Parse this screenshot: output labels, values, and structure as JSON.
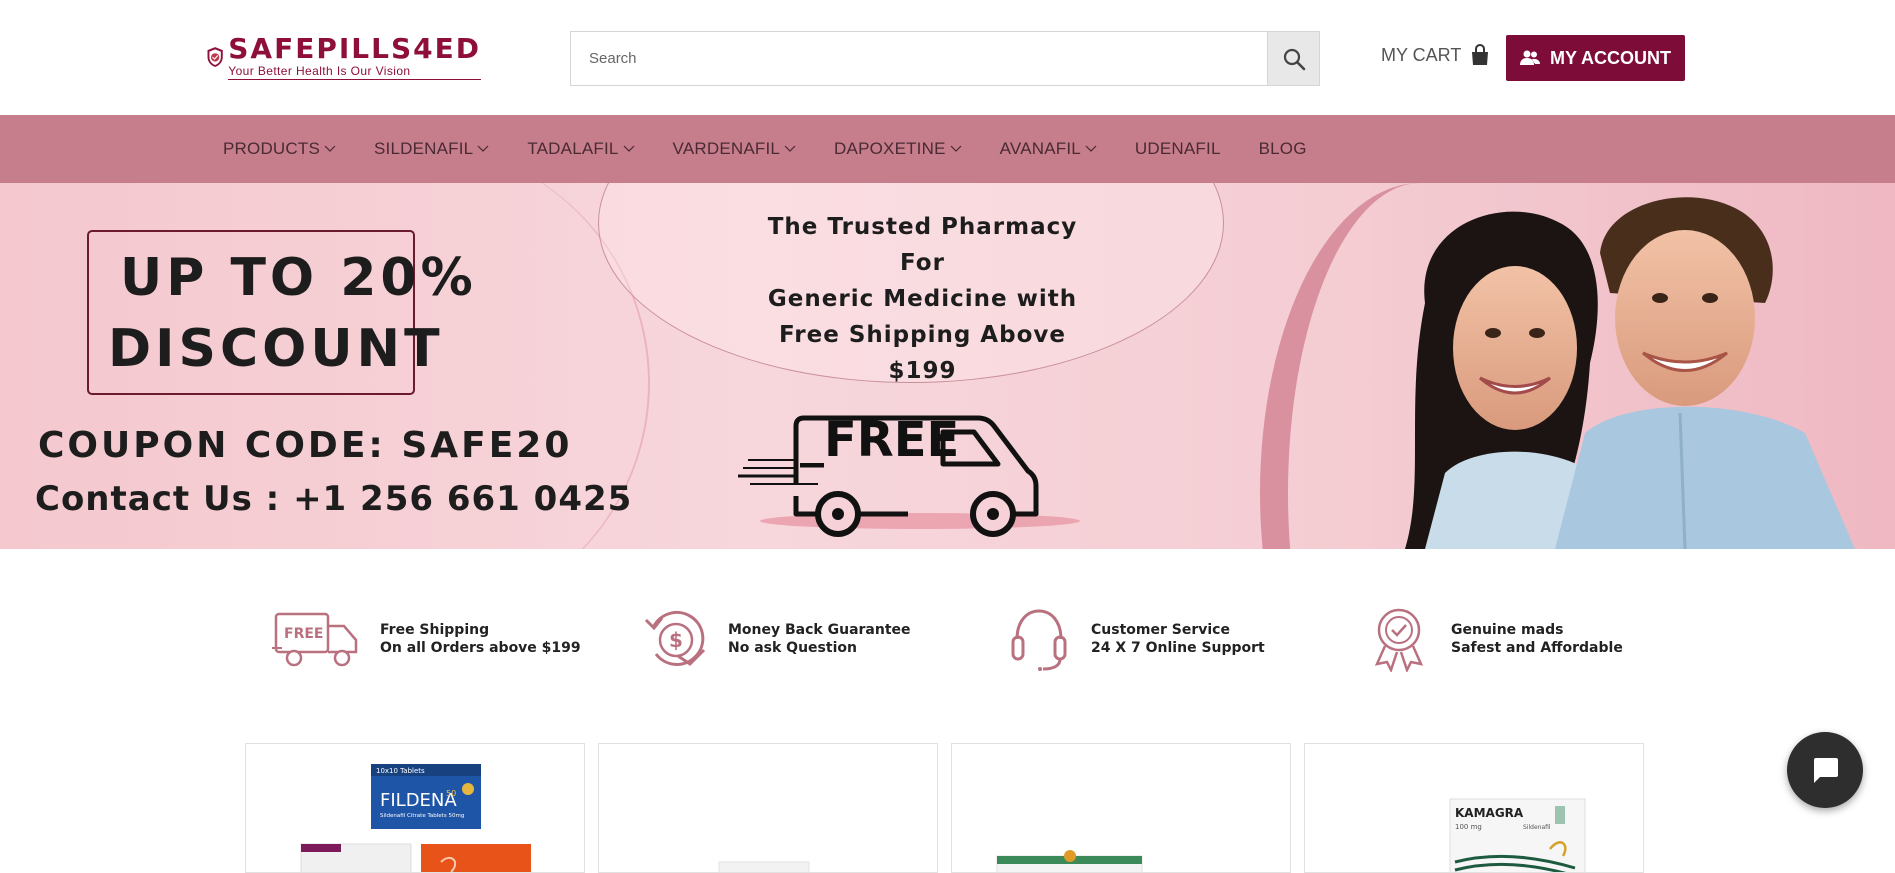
{
  "header": {
    "logo_name": "SAFEPILLS4ED",
    "logo_tagline": "Your Better Health Is Our Vision",
    "search_placeholder": "Search",
    "cart_label": "MY CART",
    "account_label": "MY ACCOUNT"
  },
  "nav": {
    "items": [
      {
        "label": "PRODUCTS",
        "has_dropdown": true
      },
      {
        "label": "SILDENAFIL",
        "has_dropdown": true
      },
      {
        "label": "TADALAFIL",
        "has_dropdown": true
      },
      {
        "label": "VARDENAFIL",
        "has_dropdown": true
      },
      {
        "label": "DAPOXETINE",
        "has_dropdown": true
      },
      {
        "label": "AVANAFIL",
        "has_dropdown": true
      },
      {
        "label": "UDENAFIL",
        "has_dropdown": false
      },
      {
        "label": "BLOG",
        "has_dropdown": false
      }
    ]
  },
  "banner": {
    "discount_line1": "UP TO 20%",
    "discount_line2": "DISCOUNT",
    "coupon": "COUPON CODE: SAFE20",
    "contact": "Contact Us : +1 256 661 0425",
    "trusted_line1": "The Trusted Pharmacy For",
    "trusted_line2": "Generic Medicine with",
    "trusted_line3": "Free Shipping Above $199",
    "truck_label": "_FREE"
  },
  "features": [
    {
      "icon": "free-shipping-truck-icon",
      "line1": "Free Shipping",
      "line2": "On all  Orders above $199"
    },
    {
      "icon": "money-back-icon",
      "line1": "Money Back Guarantee",
      "line2": "No ask Question"
    },
    {
      "icon": "headset-icon",
      "line1": "Customer Service",
      "line2": "24 X 7 Online Support"
    },
    {
      "icon": "award-badge-icon",
      "line1": "Genuine mads",
      "line2": "Safest and Affordable"
    }
  ],
  "products": [
    {
      "box_brand": "FILDENA",
      "box_strength": "50",
      "box_top": "10x10 Tablets",
      "box_sub": "Sildenafil Citrate Tablets 50mg"
    },
    {
      "box_brand": "",
      "box_strength": "",
      "box_top": "",
      "box_sub": ""
    },
    {
      "box_brand": "",
      "box_strength": "",
      "box_top": "",
      "box_sub": ""
    },
    {
      "box_brand": "KAMAGRA",
      "box_strength": "100 mg",
      "box_top": "",
      "box_sub": "Sildenafil"
    }
  ],
  "colors": {
    "brand": "#7e0c38",
    "nav_bg": "#c67d8c",
    "banner_bg": "#f4c8ce",
    "icon_pink": "#b9707f"
  }
}
